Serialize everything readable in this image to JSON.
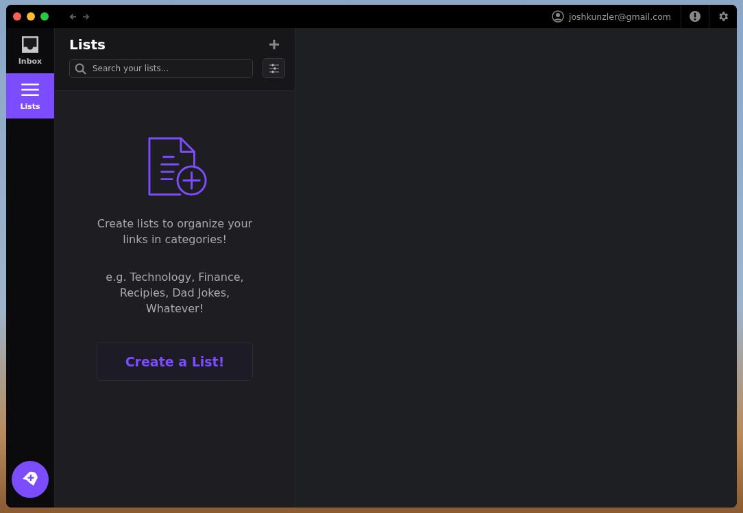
{
  "user": {
    "email": "joshkunzler@gmail.com"
  },
  "sidebar": {
    "items": [
      {
        "kind": "inbox",
        "label": "Inbox",
        "selected": false
      },
      {
        "kind": "lists",
        "label": "Lists",
        "selected": true
      }
    ]
  },
  "lists_panel": {
    "title": "Lists",
    "search": {
      "placeholder": "Search your lists..."
    },
    "empty_state": {
      "message": "Create lists to organize your links in categories!",
      "examples": "e.g. Technology, Finance, Recipies, Dad Jokes, Whatever!",
      "button": "Create a List!"
    }
  }
}
